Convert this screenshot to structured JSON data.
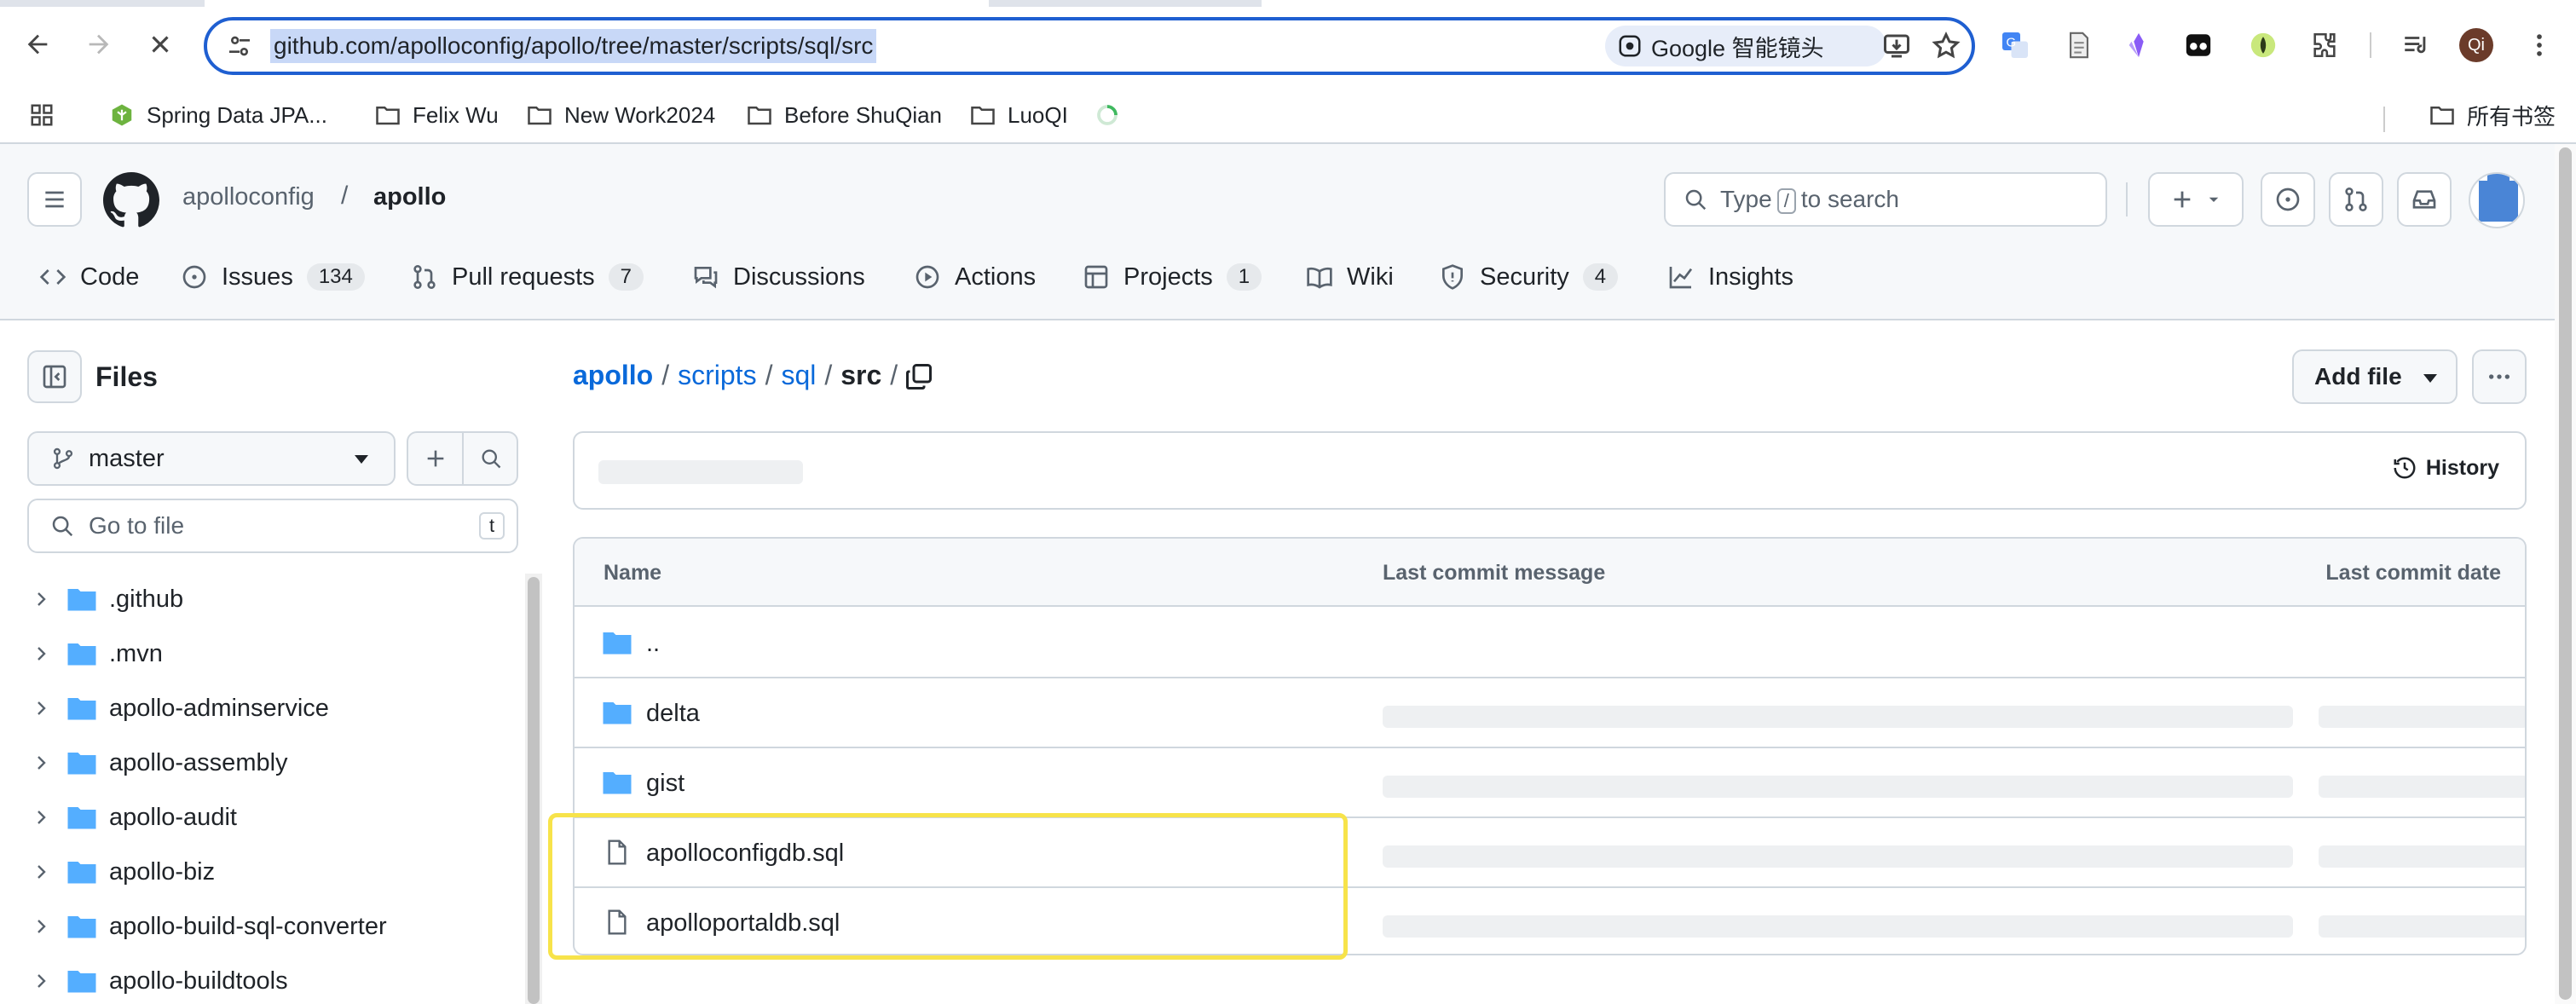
{
  "browser": {
    "url": "github.com/apolloconfig/apollo/tree/master/scripts/sql/src",
    "lens_label": "Google 智能镜头",
    "avatar_initials": "Qi",
    "bookmarks": [
      {
        "label": "Spring Data JPA..."
      },
      {
        "label": "Felix Wu"
      },
      {
        "label": "New Work2024"
      },
      {
        "label": "Before ShuQian"
      },
      {
        "label": "LuoQI"
      }
    ],
    "all_bookmarks_label": "所有书签"
  },
  "header": {
    "owner": "apolloconfig",
    "separator": "/",
    "repo": "apollo",
    "search_prefix": "Type",
    "search_key": "/",
    "search_suffix": "to search"
  },
  "repo_tabs": [
    {
      "label": "Code",
      "icon": "code-icon",
      "count": ""
    },
    {
      "label": "Issues",
      "icon": "issue-icon",
      "count": "134"
    },
    {
      "label": "Pull requests",
      "icon": "pull-request-icon",
      "count": "7"
    },
    {
      "label": "Discussions",
      "icon": "discussion-icon",
      "count": ""
    },
    {
      "label": "Actions",
      "icon": "play-icon",
      "count": ""
    },
    {
      "label": "Projects",
      "icon": "table-icon",
      "count": "1"
    },
    {
      "label": "Wiki",
      "icon": "book-icon",
      "count": ""
    },
    {
      "label": "Security",
      "icon": "shield-icon",
      "count": "4"
    },
    {
      "label": "Insights",
      "icon": "graph-icon",
      "count": ""
    }
  ],
  "sidebar": {
    "title": "Files",
    "branch": "master",
    "goto_placeholder": "Go to file",
    "goto_shortcut": "t",
    "tree": [
      {
        "name": ".github"
      },
      {
        "name": ".mvn"
      },
      {
        "name": "apollo-adminservice"
      },
      {
        "name": "apollo-assembly"
      },
      {
        "name": "apollo-audit"
      },
      {
        "name": "apollo-biz"
      },
      {
        "name": "apollo-build-sql-converter"
      },
      {
        "name": "apollo-buildtools"
      }
    ]
  },
  "breadcrumb": {
    "root": "apollo",
    "parts": [
      "scripts",
      "sql"
    ],
    "current": "src",
    "sep": "/"
  },
  "actions": {
    "add_file": "Add file",
    "history": "History"
  },
  "table": {
    "col_name": "Name",
    "col_message": "Last commit message",
    "col_date": "Last commit date",
    "rows": [
      {
        "name": "..",
        "type": "parent"
      },
      {
        "name": "delta",
        "type": "folder"
      },
      {
        "name": "gist",
        "type": "folder"
      },
      {
        "name": "apolloconfigdb.sql",
        "type": "file"
      },
      {
        "name": "apolloportaldb.sql",
        "type": "file"
      }
    ]
  },
  "colors": {
    "accent_link": "#0969da",
    "folder": "#54aeff",
    "highlight": "#f7e34a",
    "omnibox_border": "#1f5fd1"
  }
}
